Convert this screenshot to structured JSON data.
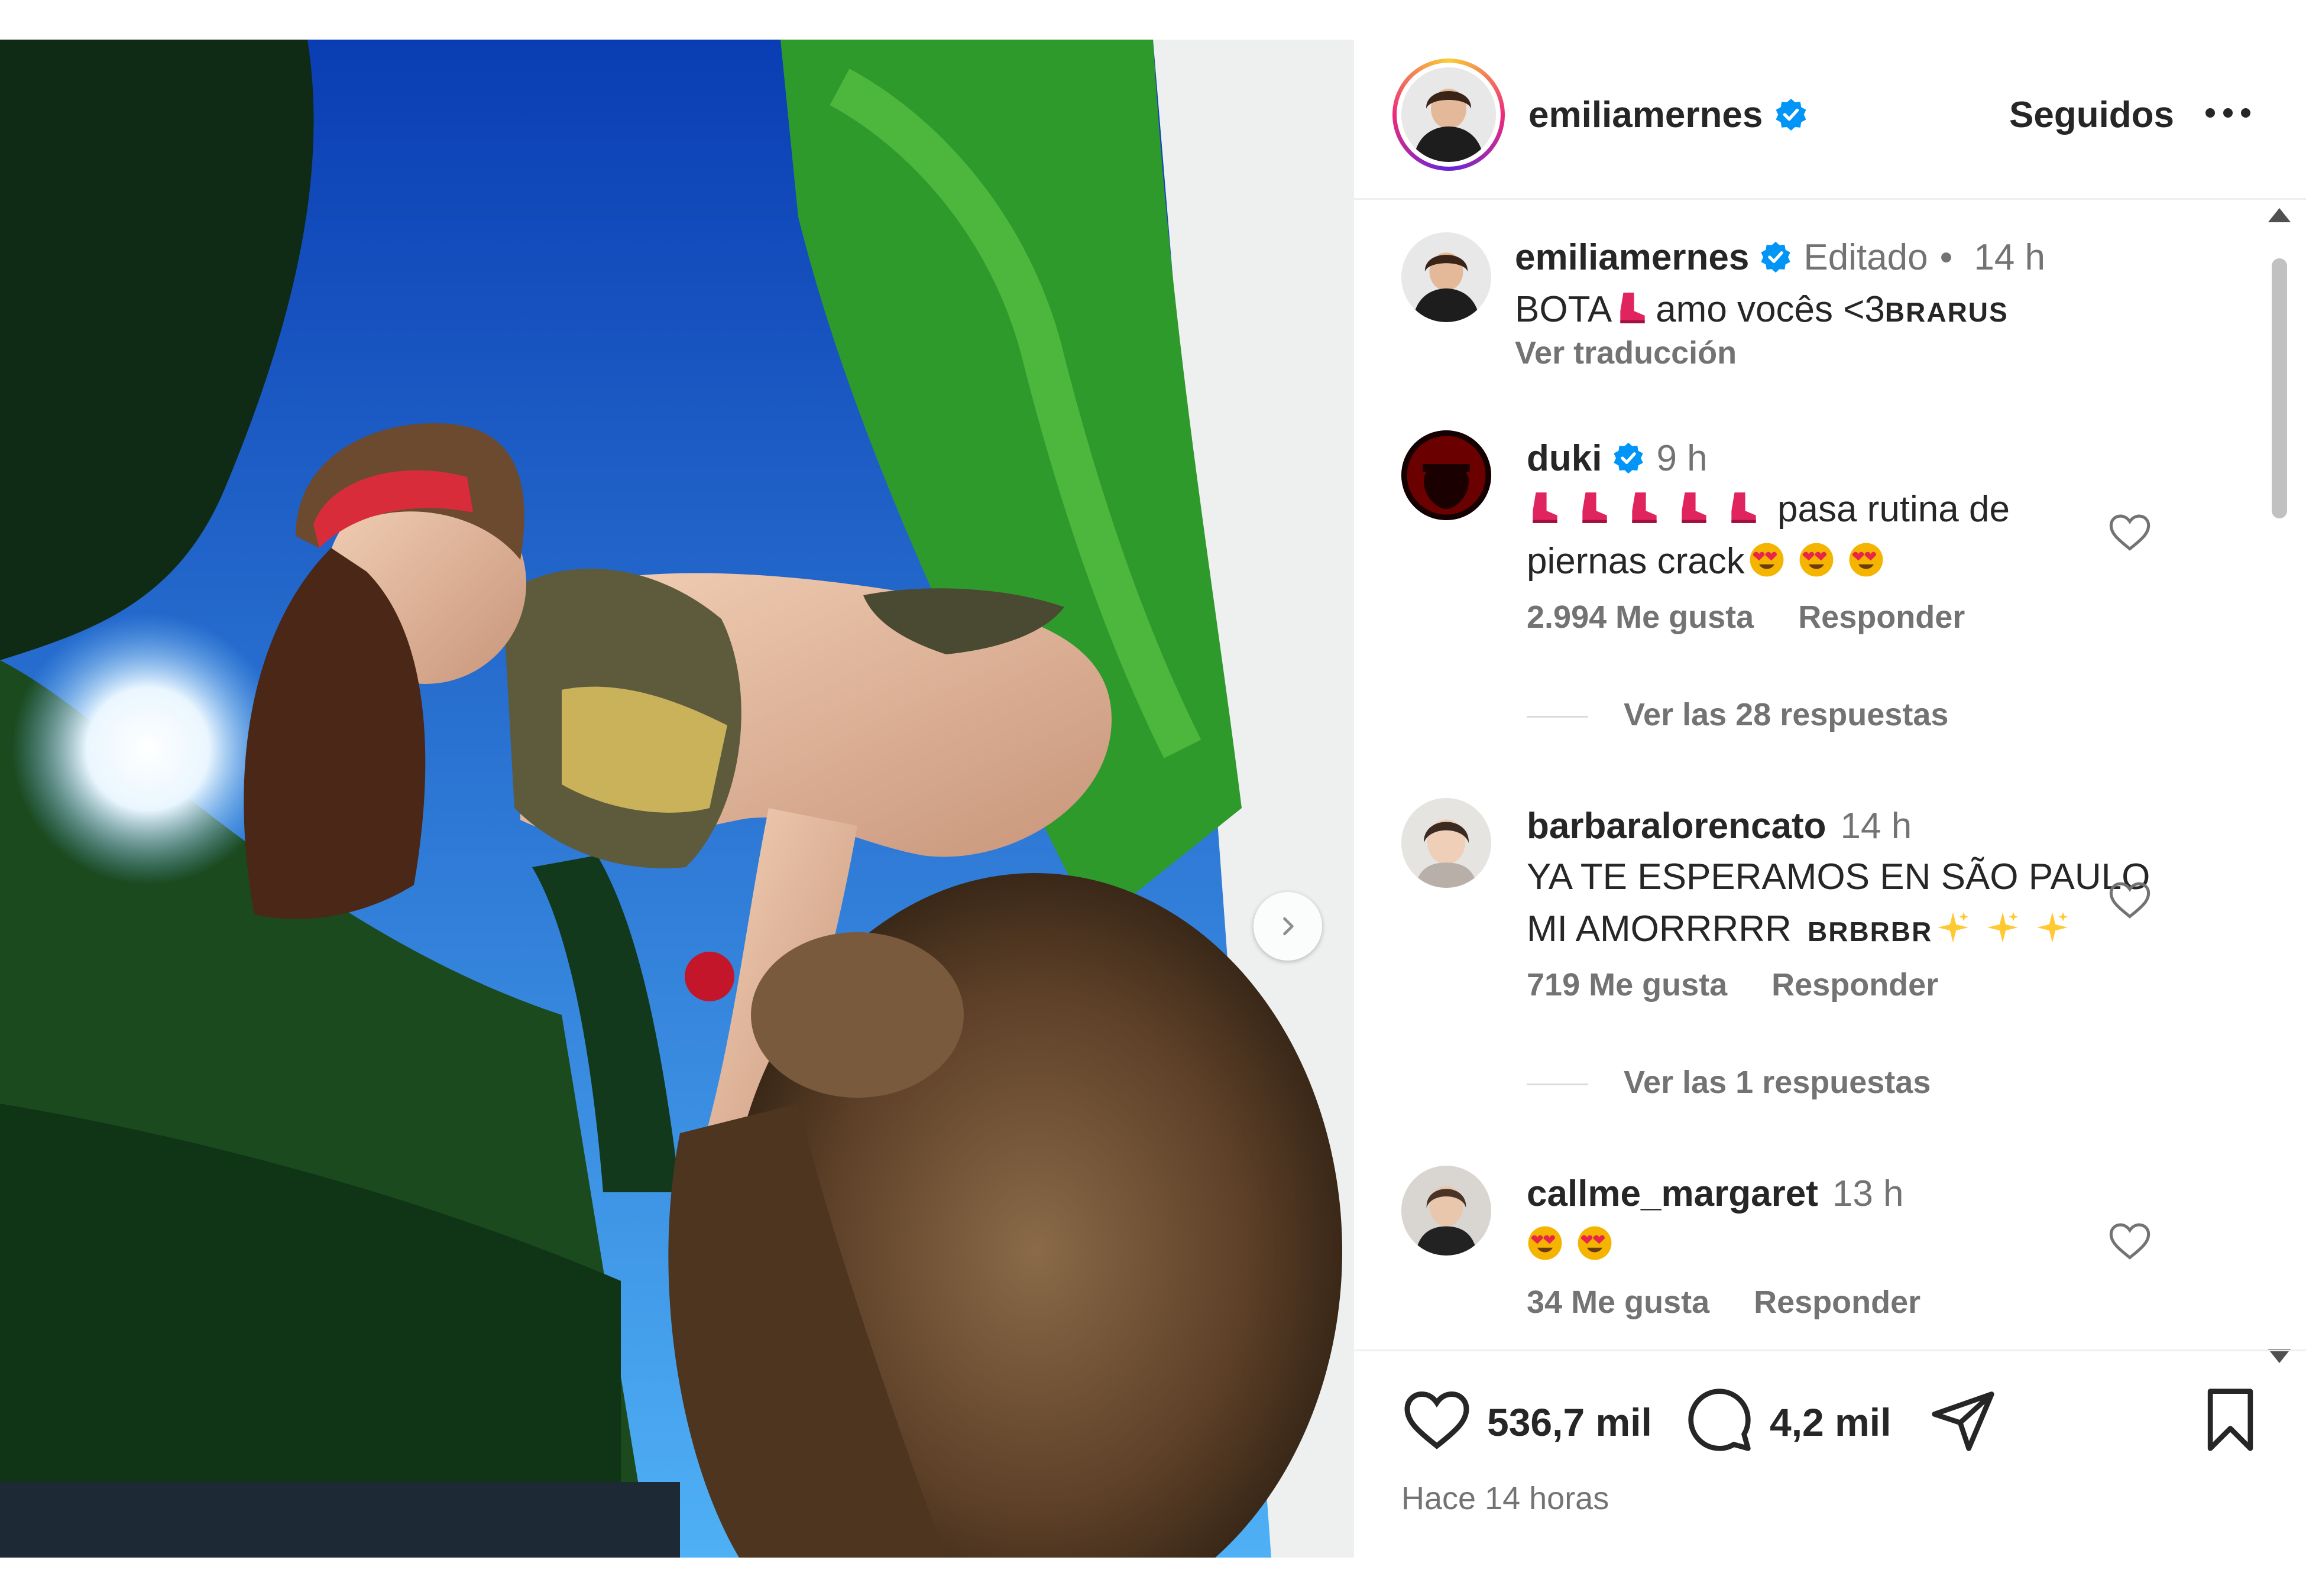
{
  "post_owner": {
    "username": "emiliamernes",
    "follow_state": "Seguidos",
    "more_icon": "more-horizontal-icon"
  },
  "caption": {
    "username": "emiliamernes",
    "edited": "Editado",
    "dot": "•",
    "time": "14 h",
    "text_before_emoji": "BOTA",
    "text_after_emoji": "amo vocês <3",
    "flag_text": "BRARUS",
    "translate": "Ver traducción"
  },
  "comments": [
    {
      "username": "duki",
      "verified": true,
      "time": "9 h",
      "line1_text": "pasa rutina de",
      "line2_text": "piernas crack",
      "likes": "2.994 Me gusta",
      "reply": "Responder",
      "replies": "Ver las 28 respuestas"
    },
    {
      "username": "barbaralorencato",
      "verified": false,
      "time": "14 h",
      "line1_text": "YA TE ESPERAMOS EN SÃO PAULO",
      "line2_text": "MI AMORRRRR",
      "flag_text": "BRBRBR",
      "likes": "719 Me gusta",
      "reply": "Responder",
      "replies": "Ver las 1 respuestas"
    },
    {
      "username": "callme_margaret",
      "verified": false,
      "time": "13 h",
      "likes": "34 Me gusta",
      "reply": "Responder"
    }
  ],
  "actions": {
    "like_count": "536,7 mil",
    "comment_count": "4,2 mil",
    "timestamp": "Hace 14 horas"
  },
  "colors": {
    "verified": "#0095f6",
    "muted": "#737373",
    "boot": "#e0245e",
    "heart_eyes": "#f4b400"
  }
}
